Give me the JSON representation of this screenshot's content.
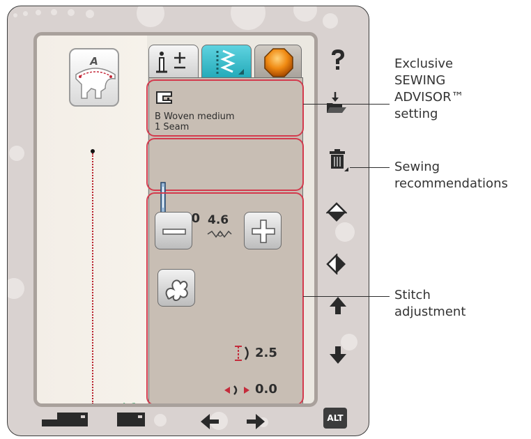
{
  "presser_foot": {
    "letter": "A"
  },
  "stitch": {
    "id": "A:1"
  },
  "tabs": [
    {
      "name": "info-tab"
    },
    {
      "name": "stitch-settings-tab"
    },
    {
      "name": "embroidery-tab"
    }
  ],
  "advisor": {
    "fabric": "B Woven medium",
    "technique": "1 Seam"
  },
  "needle": {
    "size": "80"
  },
  "stitch_adjust": {
    "width": "4.6",
    "length": "2.5",
    "position": "0.0"
  },
  "alt_label": "ALT",
  "callouts": {
    "advisor": "Exclusive\nSEWING\nADVISOR™\nsetting",
    "recommendations": "Sewing\nrecommendations",
    "adjustment": "Stitch\nadjustment"
  },
  "colors": {
    "outline": "#d33a4d",
    "accent_tab": "#22a9b8",
    "stitch_line": "#b71e2a",
    "stitch_id": "#6dba8e"
  }
}
